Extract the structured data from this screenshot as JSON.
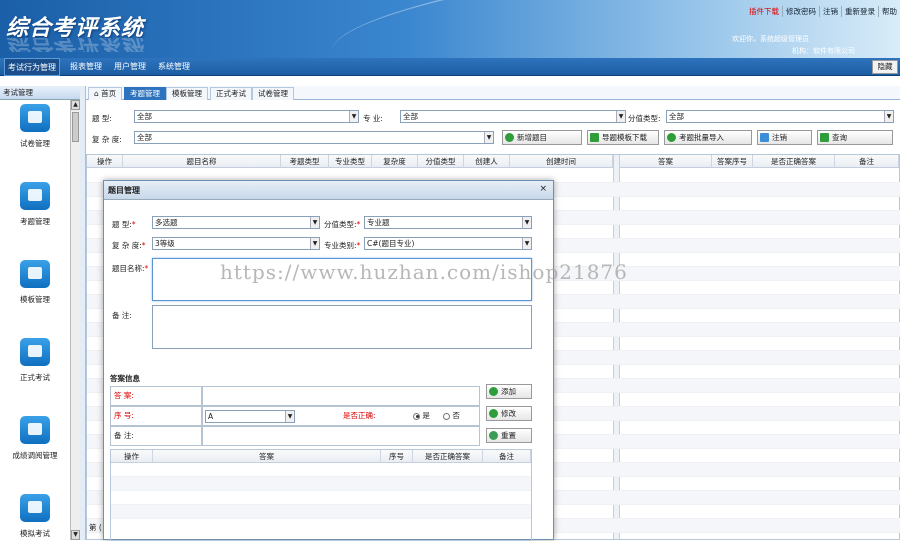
{
  "header": {
    "title": "综合考评系统",
    "links": [
      "插件下载",
      "修改密码",
      "注销",
      "重新登录",
      "帮助"
    ],
    "welcome": "欢迎你，系统超级管理员",
    "org": "机构：软件有限公司"
  },
  "menubar": {
    "items": [
      "考试行为管理",
      "报表管理",
      "用户管理",
      "系统管理"
    ],
    "hide": "隐藏"
  },
  "sidebar": {
    "title": "考试管理",
    "items": [
      {
        "label": "试卷管理",
        "icon": "paper-icon"
      },
      {
        "label": "考题管理",
        "icon": "question-list-icon"
      },
      {
        "label": "模板管理",
        "icon": "template-icon"
      },
      {
        "label": "正式考试",
        "icon": "exam-icon"
      },
      {
        "label": "成绩调阅管理",
        "icon": "score-icon"
      },
      {
        "label": "模拟考试",
        "icon": "mock-exam-icon"
      }
    ]
  },
  "tabs": [
    "首页",
    "考题管理",
    "模板管理",
    "正式考试",
    "试卷管理"
  ],
  "filters": {
    "type_label": "题    型:",
    "type_value": "全部",
    "major_label": "专    业:",
    "major_value": "全部",
    "score_type_label": "分值类型:",
    "score_type_value": "全部",
    "complexity_label": "复 杂 度:",
    "complexity_value": "全部"
  },
  "buttons": {
    "new": "新增题目",
    "download": "导题模板下载",
    "import": "考题批量导入",
    "cancel": "注销",
    "query": "查询"
  },
  "grid": {
    "headers": [
      "操作",
      "题目名称",
      "考题类型",
      "专业类型",
      "复杂度",
      "分值类型",
      "创建人",
      "创建时间",
      "答案",
      "答案序号",
      "是否正确答案",
      "备注"
    ],
    "pager": "第 ("
  },
  "modal": {
    "title": "题目管理",
    "close": "×",
    "type_label": "题    型:",
    "type_value": "多选题",
    "score_type_label": "分值类型:",
    "score_type_value": "专业题",
    "complexity_label": "复 杂 度:",
    "complexity_value": "3等级",
    "major_label": "专业类别:",
    "major_value": "C#(题目专业)",
    "name_label": "题目名称:",
    "remark_label": "备    注:",
    "answer_section": "答案信息",
    "answer_label": "答    案:",
    "seq_label": "序    号:",
    "seq_value": "A",
    "correct_label": "是否正确:",
    "yes": "是",
    "no": "否",
    "note_label": "备    注:",
    "btn_add": "添加",
    "btn_edit": "修改",
    "btn_reset": "重置",
    "table_headers": [
      "操作",
      "答案",
      "序号",
      "是否正确答案",
      "备注"
    ]
  },
  "watermark": "https://www.huzhan.com/ishop21876"
}
